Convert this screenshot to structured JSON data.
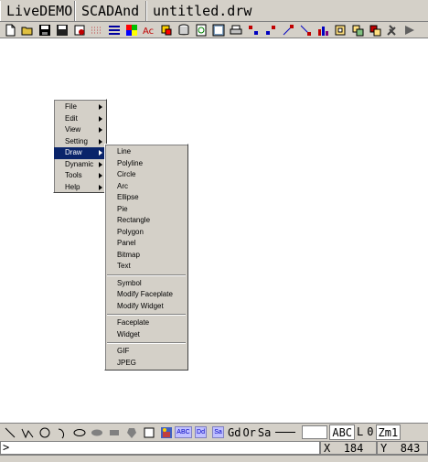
{
  "titlebar": {
    "app": "LiveDEMO",
    "project": "SCADAnd",
    "file": "untitled.drw"
  },
  "toolbar": {
    "buttons": [
      "new-file-icon",
      "open-folder-icon",
      "save-disk-icon",
      "save-all-icon",
      "print-preview-icon",
      "grid-dots-icon",
      "line-style-icon",
      "color-palette-icon",
      "font-color-icon",
      "fill-color-icon",
      "layers-icon",
      "refresh-icon",
      "properties-icon",
      "print-icon",
      "align-left-icon",
      "align-right-icon",
      "align-top-icon",
      "align-bottom-icon",
      "bar-chart-icon",
      "group-icon",
      "ungroup-icon",
      "bring-front-icon",
      "tools-icon",
      "run-icon"
    ]
  },
  "main_menu": {
    "items": [
      {
        "label": "File",
        "submenu": true
      },
      {
        "label": "Edit",
        "submenu": true
      },
      {
        "label": "View",
        "submenu": true
      },
      {
        "label": "Setting",
        "submenu": true
      },
      {
        "label": "Draw",
        "submenu": true,
        "active": true
      },
      {
        "label": "Dynamic",
        "submenu": true
      },
      {
        "label": "Tools",
        "submenu": true
      },
      {
        "label": "Help",
        "submenu": true
      }
    ]
  },
  "draw_menu": {
    "group1": [
      "Line",
      "Polyline",
      "Circle",
      "Arc",
      "Ellipse",
      "Pie",
      "Rectangle",
      "Polygon",
      "Panel",
      "Bitmap",
      "Text"
    ],
    "group2": [
      "Symbol",
      "Modify Faceplate",
      "Modify Widget"
    ],
    "group3": [
      "Faceplate",
      "Widget"
    ],
    "group4": [
      "GIF",
      "JPEG"
    ]
  },
  "drawbar": {
    "tools": [
      "line-tool-icon",
      "polyline-tool-icon",
      "circle-tool-icon",
      "arc-tool-icon",
      "ellipse-tool-icon",
      "pie-tool-icon",
      "rectangle-tool-icon",
      "polygon-tool-icon",
      "panel-tool-icon",
      "bitmap-tool-icon"
    ],
    "abc": "ABC",
    "dd": "Dd",
    "sa": "Sa",
    "gd": "Gd",
    "or": "Or",
    "sa2": "Sa",
    "font_sample": "ABC",
    "layer_label": "L",
    "layer_value": "0",
    "zoom": "Zm1"
  },
  "status": {
    "prompt": ">",
    "x_label": "X",
    "x_value": "184",
    "y_label": "Y",
    "y_value": "843"
  },
  "colors": {
    "face": "#d4d0c8",
    "highlight": "#0a246a"
  }
}
